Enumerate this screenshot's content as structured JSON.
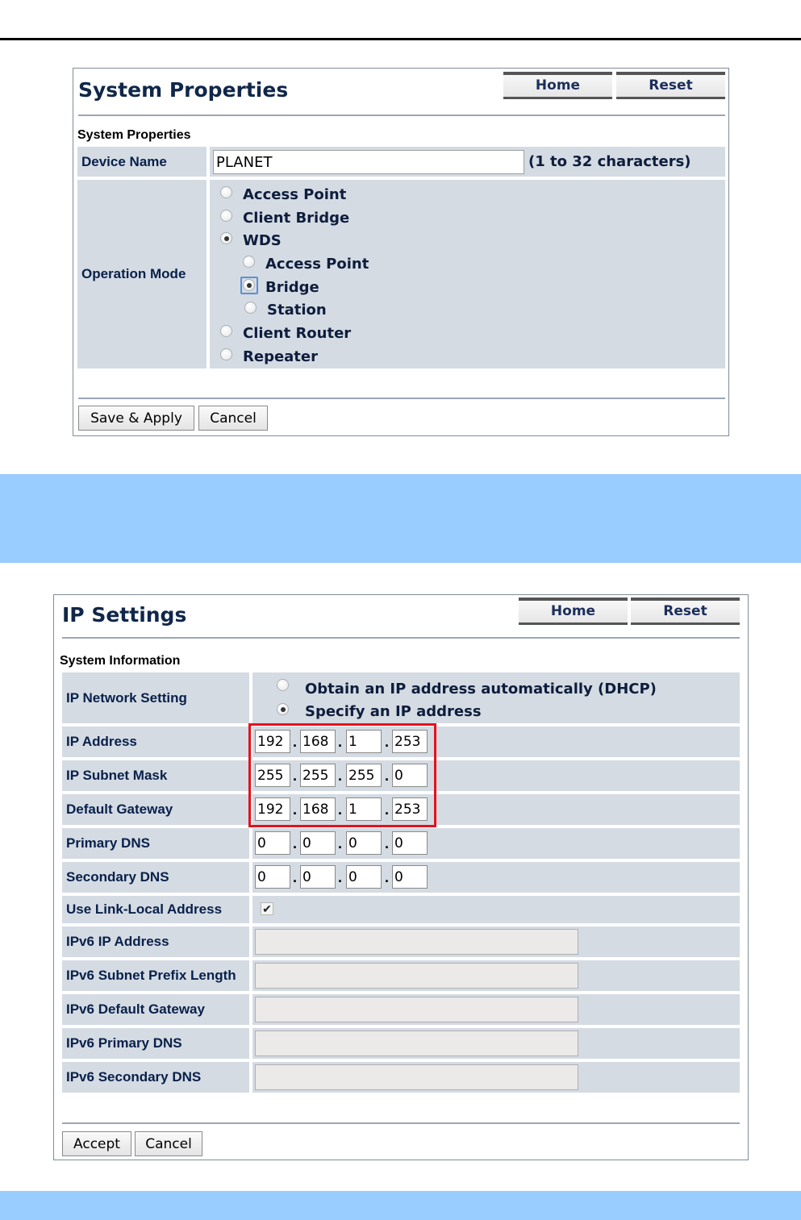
{
  "system_properties": {
    "title": "System Properties",
    "home_label": "Home",
    "reset_label": "Reset",
    "section_label": "System Properties",
    "device_name_label": "Device Name",
    "device_name_value": "PLANET",
    "device_name_hint": "(1 to 32 characters)",
    "operation_mode_label": "Operation Mode",
    "options": {
      "access_point": "Access Point",
      "client_bridge": "Client Bridge",
      "wds": "WDS",
      "wds_access_point": "Access Point",
      "wds_bridge": "Bridge",
      "wds_station": "Station",
      "client_router": "Client Router",
      "repeater": "Repeater"
    },
    "selected_mode": "WDS",
    "selected_wds_mode": "Bridge",
    "save_apply_label": "Save & Apply",
    "cancel_label": "Cancel"
  },
  "ip_settings": {
    "title": "IP Settings",
    "home_label": "Home",
    "reset_label": "Reset",
    "section_label": "System Information",
    "network_setting_label": "IP Network Setting",
    "dhcp_option": "Obtain an IP address automatically (DHCP)",
    "static_option": "Specify an IP address",
    "selected_network_setting": "Specify an IP address",
    "ip_address_label": "IP Address",
    "ip_address": [
      "192",
      "168",
      "1",
      "253"
    ],
    "subnet_mask_label": "IP Subnet Mask",
    "subnet_mask": [
      "255",
      "255",
      "255",
      "0"
    ],
    "gateway_label": "Default Gateway",
    "gateway": [
      "192",
      "168",
      "1",
      "253"
    ],
    "primary_dns_label": "Primary DNS",
    "primary_dns": [
      "0",
      "0",
      "0",
      "0"
    ],
    "secondary_dns_label": "Secondary DNS",
    "secondary_dns": [
      "0",
      "0",
      "0",
      "0"
    ],
    "link_local_label": "Use Link-Local Address",
    "link_local_checked": true,
    "link_local_mark": "✔",
    "ipv6_ip_label": "IPv6 IP Address",
    "ipv6_prefix_label": "IPv6 Subnet Prefix Length",
    "ipv6_gateway_label": "IPv6 Default Gateway",
    "ipv6_primary_dns_label": "IPv6 Primary DNS",
    "ipv6_secondary_dns_label": "IPv6 Secondary DNS",
    "accept_label": "Accept",
    "cancel_label": "Cancel"
  },
  "colors": {
    "band": "#99ccff",
    "row_bg": "#d4dbe3",
    "highlight": "#e8101a",
    "title": "#10274a"
  }
}
